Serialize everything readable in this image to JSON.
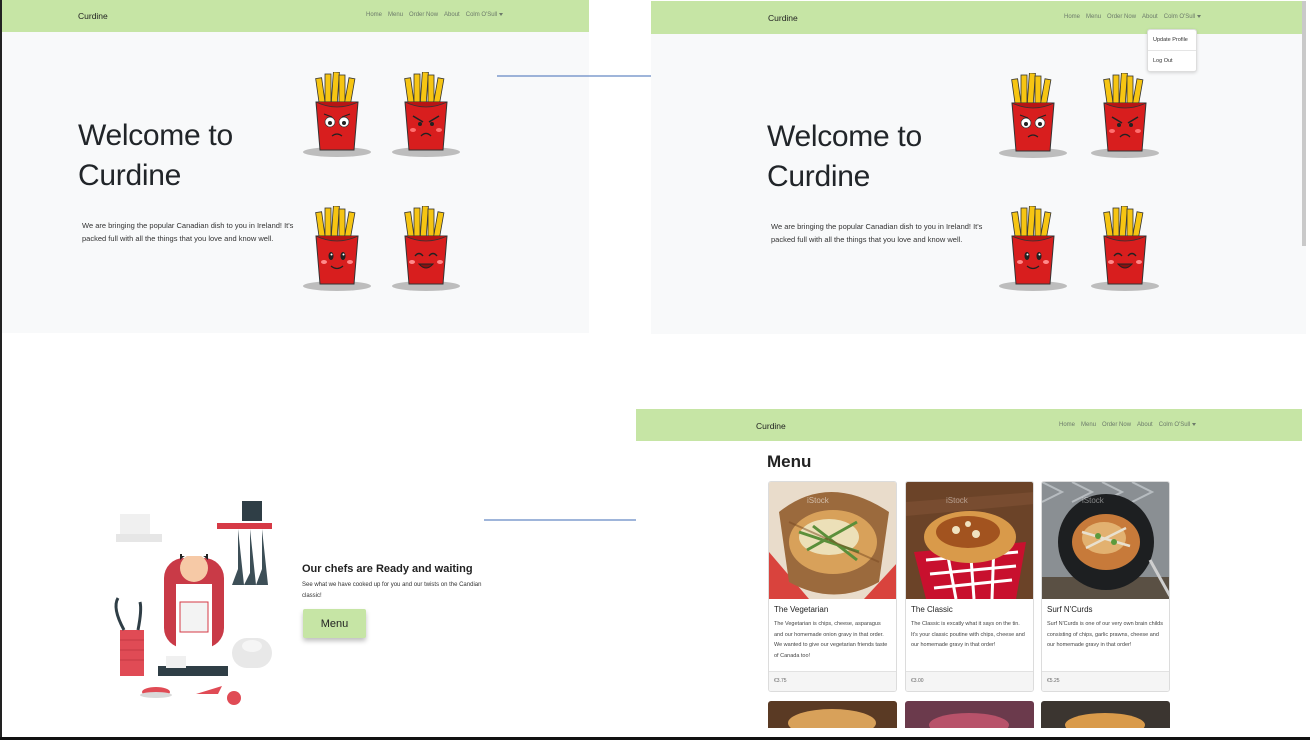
{
  "colors": {
    "navbar": "#c6e5a5",
    "fries_box": "#d81e1e",
    "fries_stick": "#f6c513",
    "arrow": "#3f6bb5"
  },
  "nav": {
    "brand": "Curdine",
    "links": [
      "Home",
      "Menu",
      "Order Now",
      "About"
    ],
    "user": "Colm O'Sull"
  },
  "hero": {
    "title_line1": "Welcome to",
    "title_line2": "Curdine",
    "text_line1": "We are bringing the popular Canadian dish to you in Ireland! It's",
    "text_line2": "packed full with all the things that you love and know well."
  },
  "dropdown": {
    "items": [
      "Update Profile",
      "Log Out"
    ]
  },
  "chefs": {
    "title": "Our chefs are Ready and waiting",
    "text": "See what we have cooked up for you and our twists on the Candian classic!",
    "button": "Menu"
  },
  "menu_page": {
    "heading": "Menu",
    "watermark": "iStock",
    "cards": [
      {
        "title": "The Vegetarian",
        "text": "The Vegetarian is chips, cheese, asparagus and our homemade onion gravy in that order. We wanted to give our vegetarian friends taste of Canada too!",
        "price": "€3.75"
      },
      {
        "title": "The Classic",
        "text": "The Classic is excatly what it says on the tin. It's your classic poutine with chips, cheese and our homemade gravy in that order!",
        "price": "€3.00"
      },
      {
        "title": "Surf N'Curds",
        "text": "Surf N'Curds is one of our very own brain childs consisting of chips, garlic prawns, cheese and our homemade gravy in that order!",
        "price": "€5.25"
      }
    ]
  }
}
